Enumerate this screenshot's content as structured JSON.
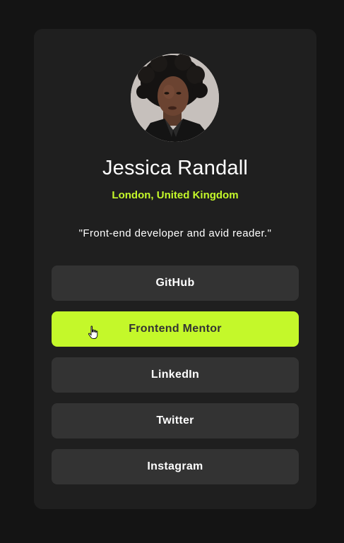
{
  "profile": {
    "name": "Jessica Randall",
    "location": "London, United Kingdom",
    "bio": "\"Front-end developer and avid reader.\""
  },
  "links": [
    {
      "label": "GitHub"
    },
    {
      "label": "Frontend Mentor"
    },
    {
      "label": "LinkedIn"
    },
    {
      "label": "Twitter"
    },
    {
      "label": "Instagram"
    }
  ],
  "colors": {
    "page_bg": "#141414",
    "card_bg": "#1f1f1f",
    "button_bg": "#333333",
    "accent": "#c4f82a",
    "text": "#ffffff"
  },
  "icons": {
    "avatar": "profile-photo",
    "cursor": "hand-pointer-icon"
  }
}
